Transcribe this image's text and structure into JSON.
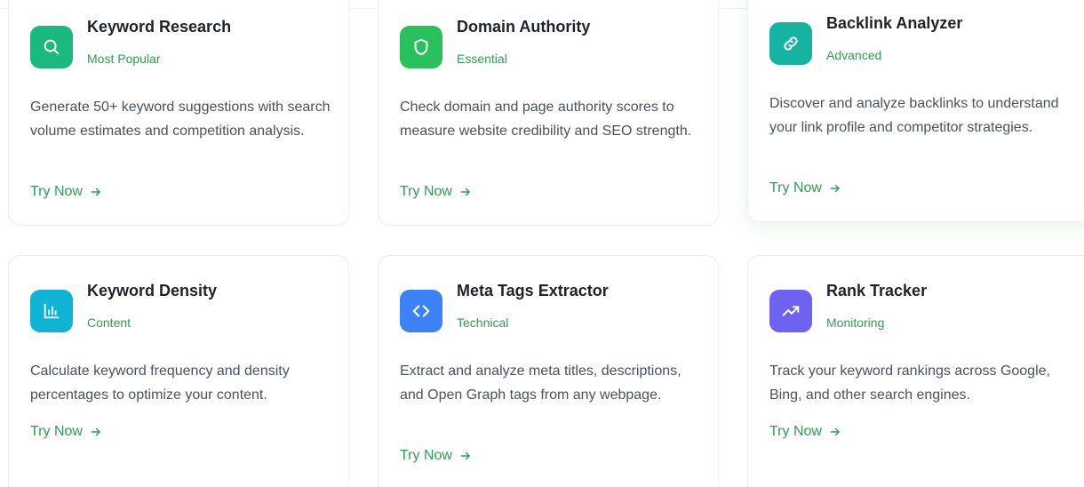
{
  "tools": [
    {
      "title": "Keyword Research",
      "tag": "Most Popular",
      "description": "Generate 50+ keyword suggestions with search volume estimates and competition analysis.",
      "cta": "Try Now",
      "icon": "search-icon",
      "icon_color": "#19b97f"
    },
    {
      "title": "Domain Authority",
      "tag": "Essential",
      "description": "Check domain and page authority scores to measure website credibility and SEO strength.",
      "cta": "Try Now",
      "icon": "shield-icon",
      "icon_color": "#28c15c"
    },
    {
      "title": "Backlink Analyzer",
      "tag": "Advanced",
      "description": "Discover and analyze backlinks to understand your link profile and competitor strategies.",
      "cta": "Try Now",
      "icon": "link-icon",
      "icon_color": "#16b3a3"
    },
    {
      "title": "Keyword Density",
      "tag": "Content",
      "description": "Calculate keyword frequency and density percentages to optimize your content.",
      "cta": "Try Now",
      "icon": "bar-chart-icon",
      "icon_color": "#0fb4d4"
    },
    {
      "title": "Meta Tags Extractor",
      "tag": "Technical",
      "description": "Extract and analyze meta titles, descriptions, and Open Graph tags from any webpage.",
      "cta": "Try Now",
      "icon": "code-icon",
      "icon_color": "#3b82f6"
    },
    {
      "title": "Rank Tracker",
      "tag": "Monitoring",
      "description": "Track your keyword rankings across Google, Bing, and other search engines.",
      "cta": "Try Now",
      "icon": "trending-up-icon",
      "icon_color": "#6d63f0"
    }
  ]
}
